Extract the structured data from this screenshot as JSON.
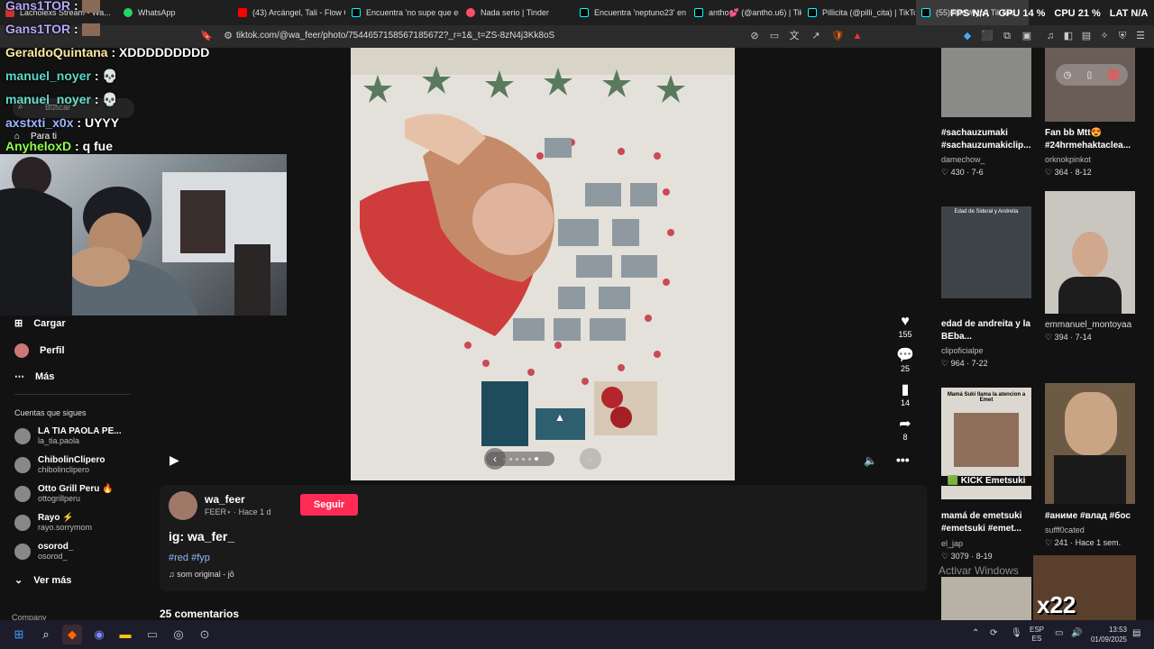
{
  "tabs": [
    {
      "label": "Lacholexs Stream - Wa..."
    },
    {
      "label": "WhatsApp"
    },
    {
      "label": "(43) Arcángel, Tali - Flow C"
    },
    {
      "label": "Encuentra 'no supe que er"
    },
    {
      "label": "Nada serio | Tinder"
    },
    {
      "label": "Encuentra 'neptuno23' en"
    },
    {
      "label": "antho💕 (@antho.u6) | Tik"
    },
    {
      "label": "Pillicita (@pilli_cita) | TikTo"
    },
    {
      "label": "(55)#red #fyp | TikTok"
    }
  ],
  "perf": {
    "fps": "FPS",
    "fps_val": "N/A",
    "gpu": "GPU",
    "gpu_val": "14 %",
    "cpu": "CPU",
    "cpu_val": "21 %",
    "lat": "LAT",
    "lat_val": "N/A"
  },
  "address": {
    "url": "tiktok.com/@wa_feer/photo/7544657158567185672?_r=1&_t=ZS-8zN4j3Kk8oS"
  },
  "chat": [
    {
      "user": "Gans1TOR",
      "text": ":",
      "color": "#b8a6ff"
    },
    {
      "user": "Gans1TOR",
      "text": ":",
      "color": "#b8a6ff"
    },
    {
      "user": "GeraldoQuintana",
      "text": ": XDDDDDDDDD",
      "color": "#ffe9a0"
    },
    {
      "user": "manuel_noyer",
      "text": ": 💀",
      "color": "#5fd9c9"
    },
    {
      "user": "manuel_noyer",
      "text": ": 💀",
      "color": "#5fd9c9"
    },
    {
      "user": "axstxti_x0x",
      "text": ": UYYY",
      "color": "#9fb8ff"
    },
    {
      "user": "AnyheloxD",
      "text": ": q fue",
      "color": "#8cff4a"
    }
  ],
  "search_placeholder": "Buscar",
  "nav": {
    "for_you": "Para ti",
    "upload": "Cargar",
    "profile": "Perfil",
    "more": "Más"
  },
  "following_title": "Cuentas que sigues",
  "accounts": [
    {
      "name": "LA TIA PAOLA PE...",
      "handle": "la_tia.paola"
    },
    {
      "name": "ChibolinClipero",
      "handle": "chibolinclipero"
    },
    {
      "name": "Otto Grill Peru 🔥",
      "handle": "ottogrillperu"
    },
    {
      "name": "Rayo ⚡",
      "handle": "rayo.sorrymom"
    },
    {
      "name": "osorod_",
      "handle": "osorod_"
    }
  ],
  "see_more": "Ver más",
  "company": "Company",
  "actions": {
    "likes": "155",
    "comments": "25",
    "saves": "14",
    "shares": "8"
  },
  "post": {
    "username": "wa_feer",
    "subtitle": "FEER⋆ · Hace 1 d",
    "follow": "Seguir",
    "caption": "ig: wa_fer_",
    "hashtags": "#red #fyp",
    "sound": "♫ som original - jō",
    "comments_count": "25 comentarios"
  },
  "recommended": [
    {
      "title": "#sachauzumaki #sachauzumakiclip...",
      "user": "damechow_",
      "stats": "♡ 430 · 7-6",
      "color": "#8a8a86"
    },
    {
      "title": "Fan bb Mtt😍 #24hrmehaktaclea...",
      "user": "orknokpinkot",
      "stats": "♡ 364 · 8-12",
      "color": "#6a5c57"
    },
    {
      "title": "edad de andreita y la BEba...",
      "user": "clipoficialpe",
      "stats": "♡ 964 · 7-22",
      "color": "#3e4449",
      "overlay": "Edad de Sideral y Andreita"
    },
    {
      "title": "",
      "user": "emmanuel_montoyaa",
      "stats": "♡ 394 · 7-14",
      "color": "#c9c6c0"
    },
    {
      "title": "mamá de emetsuki #emetsuki #emet...",
      "user": "el_jap",
      "stats": "♡ 3079 · 8-19",
      "color": "#dcd7d0",
      "overlay": "Mamá Suki llama la atencion a Emet",
      "badge": "🟩 KICK Emetsuki"
    },
    {
      "title": "#аниме #влад #бос",
      "user": "sufff0cated",
      "stats": "♡ 241 · Hace 1 sem.",
      "color": "#6d5a45"
    }
  ],
  "watermark": "Activar Windows",
  "bottom_badge": "x22",
  "taskbar": {
    "lang1": "ESP",
    "lang2": "ES",
    "time": "13:53",
    "date": "01/09/2025"
  }
}
